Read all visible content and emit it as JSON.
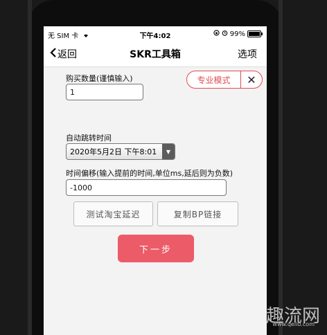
{
  "status_bar": {
    "carrier": "无 SIM 卡",
    "time": "下午4:02",
    "battery": "99%",
    "battery_level": 0.99,
    "icons": [
      "wifi-icon",
      "orientation-lock-icon",
      "alarm-icon",
      "battery-icon"
    ]
  },
  "nav": {
    "back_label": "返回",
    "title": "SKR工具箱",
    "options_label": "选项"
  },
  "form": {
    "quantity_label": "购买数量(谨慎输入)",
    "quantity_value": "1",
    "mode_label": "专业模式",
    "mode_close": "✕",
    "jump_time_label": "自动跳转时间",
    "jump_time_value": "2020年5月2日 下午8:01",
    "offset_label": "时间偏移(输入提前的时间,单位ms,延后则为负数)",
    "offset_value": "-1000"
  },
  "buttons": {
    "test_delay": "测试淘宝延迟",
    "copy_bp": "复制BP链接",
    "next": "下一步"
  },
  "watermark": {
    "text": "趣流网",
    "url": "www.qeliu.com"
  },
  "colors": {
    "accent": "#e04b53",
    "next_button": "#ec5b68"
  }
}
